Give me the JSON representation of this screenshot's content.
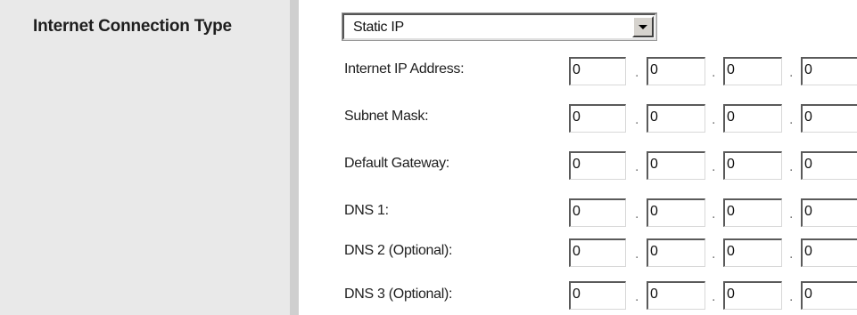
{
  "sidebar": {
    "title": "Internet Connection Type"
  },
  "connection_type": {
    "selected": "Static IP"
  },
  "separator": ".",
  "rows": [
    {
      "label": "Internet IP Address:",
      "octets": [
        "0",
        "0",
        "0",
        "0"
      ]
    },
    {
      "label": "Subnet Mask:",
      "octets": [
        "0",
        "0",
        "0",
        "0"
      ]
    },
    {
      "label": "Default Gateway:",
      "octets": [
        "0",
        "0",
        "0",
        "0"
      ]
    },
    {
      "label": "DNS 1:",
      "octets": [
        "0",
        "0",
        "0",
        "0"
      ]
    },
    {
      "label": "DNS 2 (Optional):",
      "octets": [
        "0",
        "0",
        "0",
        "0"
      ]
    },
    {
      "label": "DNS 3 (Optional):",
      "octets": [
        "0",
        "0",
        "0",
        "0"
      ]
    }
  ]
}
